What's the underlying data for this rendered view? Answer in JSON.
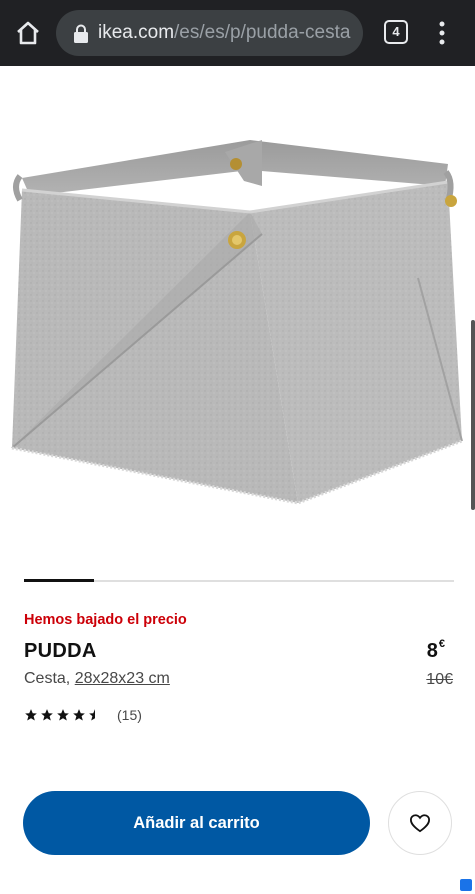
{
  "browser": {
    "url_host": "ikea.com",
    "url_path": "/es/es/p/pudda-cesta",
    "tab_count": "4"
  },
  "product": {
    "price_drop_label": "Hemos bajado el precio",
    "name": "PUDDA",
    "type": "Cesta,",
    "dimensions": "28x28x23 cm",
    "price_new": "8",
    "price_new_currency": "€",
    "price_old": "10",
    "price_old_currency": "€",
    "rating": 4.5,
    "review_count": "(15)"
  },
  "actions": {
    "add_to_cart": "Añadir al carrito"
  },
  "colors": {
    "chrome_bg": "#202124",
    "accent_blue": "#0058a3",
    "price_drop_red": "#cc0008"
  }
}
